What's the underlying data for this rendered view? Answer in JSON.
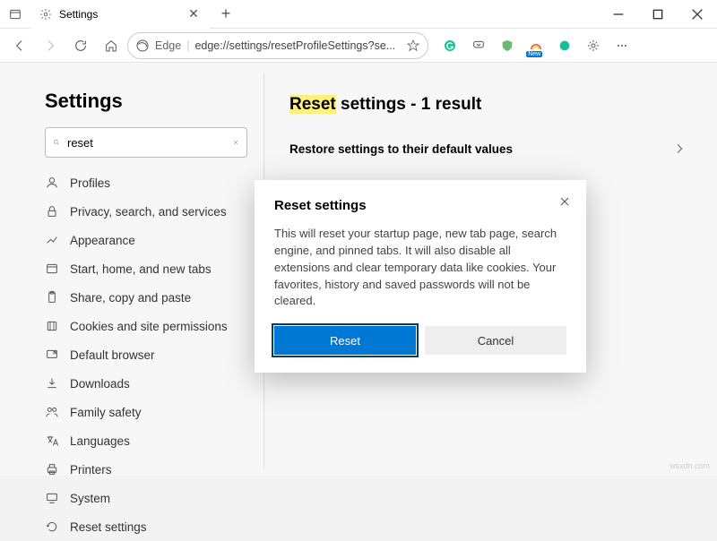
{
  "tab": {
    "title": "Settings"
  },
  "toolbar": {
    "edge_label": "Edge",
    "url": "edge://settings/resetProfileSettings?se..."
  },
  "extensions": {
    "new_badge": "New"
  },
  "sidebar": {
    "title": "Settings",
    "search_value": "reset",
    "items": [
      {
        "label": "Profiles"
      },
      {
        "label": "Privacy, search, and services"
      },
      {
        "label": "Appearance"
      },
      {
        "label": "Start, home, and new tabs"
      },
      {
        "label": "Share, copy and paste"
      },
      {
        "label": "Cookies and site permissions"
      },
      {
        "label": "Default browser"
      },
      {
        "label": "Downloads"
      },
      {
        "label": "Family safety"
      },
      {
        "label": "Languages"
      },
      {
        "label": "Printers"
      },
      {
        "label": "System"
      },
      {
        "label": "Reset settings"
      }
    ]
  },
  "main": {
    "heading_highlight": "Reset",
    "heading_rest": " settings - 1 result",
    "result_label": "Restore settings to their default values"
  },
  "dialog": {
    "title": "Reset settings",
    "body": "This will reset your startup page, new tab page, search engine, and pinned tabs. It will also disable all extensions and clear temporary data like cookies. Your favorites, history and saved passwords will not be cleared.",
    "primary": "Reset",
    "secondary": "Cancel"
  },
  "watermark": "wsxdn.com"
}
